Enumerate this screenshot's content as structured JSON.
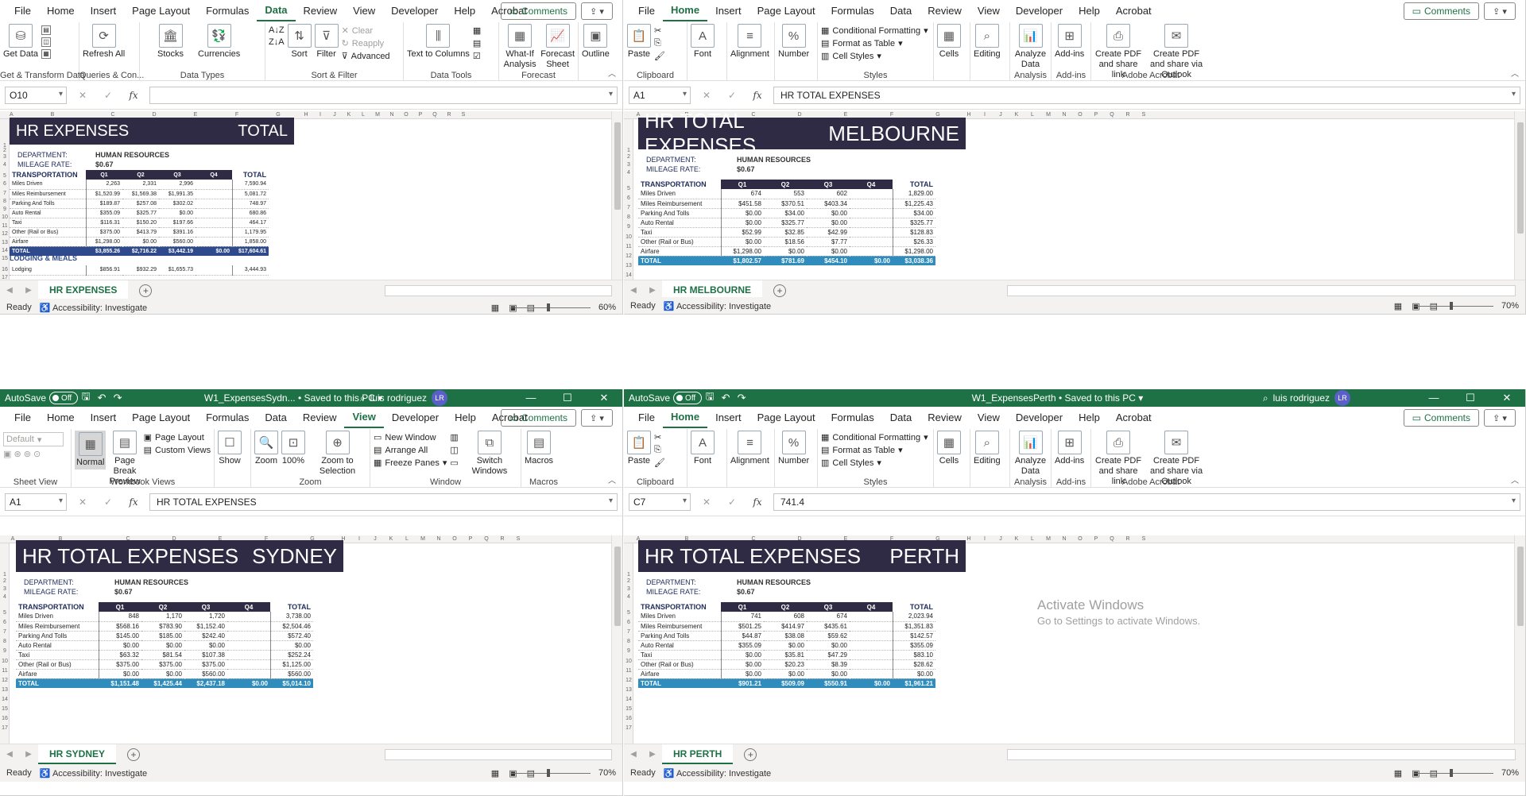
{
  "tl": {
    "menu": [
      "File",
      "Home",
      "Insert",
      "Page Layout",
      "Formulas",
      "Data",
      "Review",
      "View",
      "Developer",
      "Help",
      "Acrobat"
    ],
    "active": "Data",
    "comments": "Comments",
    "groups": {
      "get_transform": "Get & Transform Data",
      "queries": "Queries & Con...",
      "data_types": "Data Types",
      "sort_filter": "Sort & Filter",
      "data_tools": "Data Tools",
      "forecast": "Forecast"
    },
    "buttons": {
      "get_data": "Get Data",
      "refresh": "Refresh All",
      "stocks": "Stocks",
      "currencies": "Currencies",
      "sort": "Sort",
      "filter": "Filter",
      "clear": "Clear",
      "reapply": "Reapply",
      "advanced": "Advanced",
      "text_to_columns": "Text to Columns",
      "what_if": "What-If Analysis",
      "forecast_sheet": "Forecast Sheet",
      "outline": "Outline"
    },
    "namebox": "O10",
    "formula": "",
    "title_left": "HR EXPENSES",
    "title_right": "TOTAL",
    "dept_label": "DEPARTMENT:",
    "dept_value": "HUMAN RESOURCES",
    "mileage_label": "MILEAGE RATE:",
    "mileage_value": "$0.67",
    "section": "TRANSPORTATION",
    "q": [
      "Q1",
      "Q2",
      "Q3",
      "Q4",
      "TOTAL"
    ],
    "rows": [
      [
        "Miles Driven",
        "2,263",
        "2,331",
        "2,996",
        "",
        "7,590.94"
      ],
      [
        "Miles Reimbursement",
        "$1,520.99",
        "$1,569.38",
        "$1,991.35",
        "",
        "5,081.72"
      ],
      [
        "Parking And Tolls",
        "$189.87",
        "$257.08",
        "$302.02",
        "",
        "748.97"
      ],
      [
        "Auto Rental",
        "$355.09",
        "$325.77",
        "$0.00",
        "",
        "680.86"
      ],
      [
        "Taxi",
        "$116.31",
        "$150.20",
        "$197.66",
        "",
        "464.17"
      ],
      [
        "Other (Rail or Bus)",
        "$375.00",
        "$413.79",
        "$391.16",
        "",
        "1,179.95"
      ],
      [
        "Airfare",
        "$1,298.00",
        "$0.00",
        "$560.00",
        "",
        "1,858.00"
      ]
    ],
    "total": [
      "TOTAL",
      "$3,855.26",
      "$2,716.22",
      "$3,442.19",
      "$0.00",
      "$17,604.61"
    ],
    "lodging": "LODGING & MEALS",
    "lodging_row": [
      "Lodging",
      "$856.91",
      "$932.29",
      "$1,655.73",
      "",
      "3,444.93"
    ],
    "tab": "HR EXPENSES",
    "zoom": "60%"
  },
  "tr": {
    "menu": [
      "File",
      "Home",
      "Insert",
      "Page Layout",
      "Formulas",
      "Data",
      "Review",
      "View",
      "Developer",
      "Help",
      "Acrobat"
    ],
    "active": "Home",
    "comments": "Comments",
    "namebox": "A1",
    "formula": "HR TOTAL EXPENSES",
    "title_left": "HR TOTAL EXPENSES",
    "title_right": "MELBOURNE",
    "dept_label": "DEPARTMENT:",
    "dept_value": "HUMAN RESOURCES",
    "mileage_label": "MILEAGE RATE:",
    "mileage_value": "$0.67",
    "section": "TRANSPORTATION",
    "q": [
      "Q1",
      "Q2",
      "Q3",
      "Q4",
      "TOTAL"
    ],
    "rows": [
      [
        "Miles Driven",
        "674",
        "553",
        "602",
        "",
        "1,829.00"
      ],
      [
        "Miles Reimbursement",
        "$451.58",
        "$370.51",
        "$403.34",
        "",
        "$1,225.43"
      ],
      [
        "Parking And Tolls",
        "$0.00",
        "$34.00",
        "$0.00",
        "",
        "$34.00"
      ],
      [
        "Auto Rental",
        "$0.00",
        "$325.77",
        "$0.00",
        "",
        "$325.77"
      ],
      [
        "Taxi",
        "$52.99",
        "$32.85",
        "$42.99",
        "",
        "$128.83"
      ],
      [
        "Other (Rail or Bus)",
        "$0.00",
        "$18.56",
        "$7.77",
        "",
        "$26.33"
      ],
      [
        "Airfare",
        "$1,298.00",
        "$0.00",
        "$0.00",
        "",
        "$1,298.00"
      ]
    ],
    "total": [
      "TOTAL",
      "$1,802.57",
      "$781.69",
      "$454.10",
      "$0.00",
      "$3,038.36"
    ],
    "tab": "HR MELBOURNE",
    "zoom": "70%"
  },
  "bl": {
    "menu": [
      "File",
      "Home",
      "Insert",
      "Page Layout",
      "Formulas",
      "Data",
      "Review",
      "View",
      "Developer",
      "Help",
      "Acrobat"
    ],
    "active": "View",
    "comments": "Comments",
    "autosave": "AutoSave",
    "autosave_state": "Off",
    "filename": "W1_ExpensesSydn...",
    "saved": "• Saved to this PC",
    "user": "luis rodriguez",
    "initials": "LR",
    "namebox": "A1",
    "formula": "HR TOTAL EXPENSES",
    "title_left": "HR TOTAL EXPENSES",
    "title_right": "SYDNEY",
    "dept_label": "DEPARTMENT:",
    "dept_value": "HUMAN RESOURCES",
    "mileage_label": "MILEAGE RATE:",
    "mileage_value": "$0.67",
    "section": "TRANSPORTATION",
    "q": [
      "Q1",
      "Q2",
      "Q3",
      "Q4",
      "TOTAL"
    ],
    "rows": [
      [
        "Miles Driven",
        "848",
        "1,170",
        "1,720",
        "",
        "3,738.00"
      ],
      [
        "Miles Reimbursement",
        "$568.16",
        "$783.90",
        "$1,152.40",
        "",
        "$2,504.46"
      ],
      [
        "Parking And Tolls",
        "$145.00",
        "$185.00",
        "$242.40",
        "",
        "$572.40"
      ],
      [
        "Auto Rental",
        "$0.00",
        "$0.00",
        "$0.00",
        "",
        "$0.00"
      ],
      [
        "Taxi",
        "$63.32",
        "$81.54",
        "$107.38",
        "",
        "$252.24"
      ],
      [
        "Other (Rail or Bus)",
        "$375.00",
        "$375.00",
        "$375.00",
        "",
        "$1,125.00"
      ],
      [
        "Airfare",
        "$0.00",
        "$0.00",
        "$560.00",
        "",
        "$560.00"
      ]
    ],
    "total": [
      "TOTAL",
      "$1,151.48",
      "$1,425.44",
      "$2,437.18",
      "$0.00",
      "$5,014.10"
    ],
    "tab": "HR SYDNEY",
    "zoom": "70%"
  },
  "br": {
    "menu": [
      "File",
      "Home",
      "Insert",
      "Page Layout",
      "Formulas",
      "Data",
      "Review",
      "View",
      "Developer",
      "Help",
      "Acrobat"
    ],
    "active": "Home",
    "comments": "Comments",
    "autosave": "AutoSave",
    "autosave_state": "Off",
    "filename": "W1_ExpensesPerth",
    "saved": "• Saved to this PC",
    "user": "luis rodriguez",
    "initials": "LR",
    "namebox": "C7",
    "formula": "741.4",
    "title_left": "HR TOTAL EXPENSES",
    "title_right": "PERTH",
    "dept_label": "DEPARTMENT:",
    "dept_value": "HUMAN RESOURCES",
    "mileage_label": "MILEAGE RATE:",
    "mileage_value": "$0.67",
    "section": "TRANSPORTATION",
    "q": [
      "Q1",
      "Q2",
      "Q3",
      "Q4",
      "TOTAL"
    ],
    "rows": [
      [
        "Miles Driven",
        "741",
        "608",
        "674",
        "",
        "2,023.94"
      ],
      [
        "Miles Reimbursement",
        "$501.25",
        "$414.97",
        "$435.61",
        "",
        "$1,351.83"
      ],
      [
        "Parking And Tolls",
        "$44.87",
        "$38.08",
        "$59.62",
        "",
        "$142.57"
      ],
      [
        "Auto Rental",
        "$355.09",
        "$0.00",
        "$0.00",
        "",
        "$355.09"
      ],
      [
        "Taxi",
        "$0.00",
        "$35.81",
        "$47.29",
        "",
        "$83.10"
      ],
      [
        "Other (Rail or Bus)",
        "$0.00",
        "$20.23",
        "$8.39",
        "",
        "$28.62"
      ],
      [
        "Airfare",
        "$0.00",
        "$0.00",
        "$0.00",
        "",
        "$0.00"
      ]
    ],
    "total": [
      "TOTAL",
      "$901.21",
      "$509.09",
      "$550.91",
      "$0.00",
      "$1,961.21"
    ],
    "tab": "HR PERTH",
    "zoom": "70%",
    "watermark_title": "Activate Windows",
    "watermark_sub": "Go to Settings to activate Windows."
  },
  "home_ribbon": {
    "paste": "Paste",
    "font": "Font",
    "alignment": "Alignment",
    "number": "Number",
    "cond_fmt": "Conditional Formatting",
    "fmt_table": "Format as Table",
    "cell_styles": "Cell Styles",
    "cells": "Cells",
    "editing": "Editing",
    "analyze": "Analyze Data",
    "addins": "Add-ins",
    "pdf_link": "Create PDF and share link",
    "pdf_outlook": "Create PDF and share via Outlook",
    "groups": {
      "clipboard": "Clipboard",
      "styles": "Styles",
      "analysis": "Analysis",
      "addins": "Add-ins",
      "acrobat": "Adobe Acrobat"
    }
  },
  "view_ribbon": {
    "default": "Default",
    "normal": "Normal",
    "page_break": "Page Break Preview",
    "page_layout": "Page Layout",
    "custom_views": "Custom Views",
    "show": "Show",
    "zoom": "Zoom",
    "hundred": "100%",
    "zoom_sel": "Zoom to Selection",
    "new_window": "New Window",
    "arrange_all": "Arrange All",
    "freeze": "Freeze Panes",
    "switch": "Switch Windows",
    "macros": "Macros",
    "groups": {
      "sheet_view": "Sheet View",
      "workbook_views": "Workbook Views",
      "zoom": "Zoom",
      "window": "Window",
      "macros": "Macros"
    }
  },
  "status": {
    "ready": "Ready",
    "access": "Accessibility: Investigate"
  },
  "cols": [
    "A",
    "B",
    "C",
    "D",
    "E",
    "F",
    "G",
    "H",
    "I",
    "J",
    "K",
    "L",
    "M",
    "N",
    "O",
    "P",
    "Q",
    "R",
    "S"
  ],
  "row_numbers": [
    "1",
    "2",
    "3",
    "4",
    "5",
    "6",
    "7",
    "8",
    "9",
    "10",
    "11",
    "12",
    "13",
    "14",
    "15",
    "16",
    "17"
  ]
}
